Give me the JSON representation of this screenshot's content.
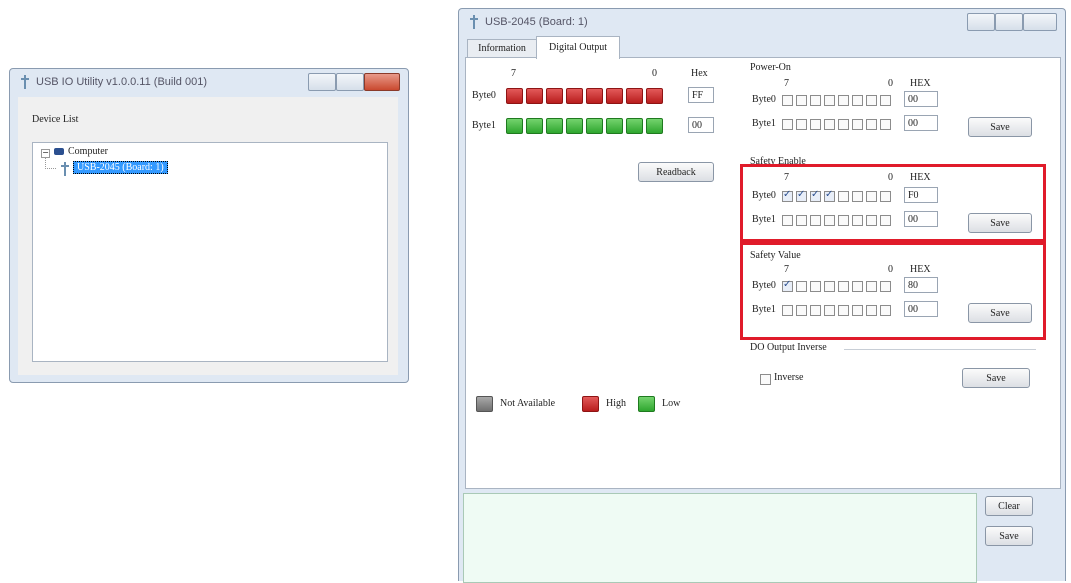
{
  "left_window": {
    "title": "USB IO Utility    v1.0.0.11 (Build 001)",
    "device_list_label": "Device List",
    "tree": {
      "root": "Computer",
      "child": "USB-2045 (Board: 1)"
    }
  },
  "right_window": {
    "title": "USB-2045 (Board: 1)",
    "tabs": [
      "Information",
      "Digital Output"
    ],
    "active_tab": "Digital Output",
    "do_panel": {
      "bit_high": "7",
      "bit_low": "0",
      "hex_header": "Hex",
      "byte0_label": "Byte0",
      "byte1_label": "Byte1",
      "byte0_hex": "FF",
      "byte1_hex": "00",
      "byte0_states": [
        "high",
        "high",
        "high",
        "high",
        "high",
        "high",
        "high",
        "high"
      ],
      "byte1_states": [
        "low",
        "low",
        "low",
        "low",
        "low",
        "low",
        "low",
        "low"
      ],
      "readback_label": "Readback"
    },
    "legend": {
      "not_available": "Not Available",
      "high": "High",
      "low": "Low"
    },
    "power_on": {
      "title": "Power-On",
      "bit_high": "7",
      "bit_low": "0",
      "hex_header": "HEX",
      "byte0_label": "Byte0",
      "byte1_label": "Byte1",
      "byte0_hex": "00",
      "byte1_hex": "00",
      "byte0_bits": [
        false,
        false,
        false,
        false,
        false,
        false,
        false,
        false
      ],
      "byte1_bits": [
        false,
        false,
        false,
        false,
        false,
        false,
        false,
        false
      ],
      "save_label": "Save"
    },
    "safety_enable": {
      "title": "Safety Enable",
      "bit_high": "7",
      "bit_low": "0",
      "hex_header": "HEX",
      "byte0_label": "Byte0",
      "byte1_label": "Byte1",
      "byte0_hex": "F0",
      "byte1_hex": "00",
      "byte0_bits": [
        true,
        true,
        true,
        true,
        false,
        false,
        false,
        false
      ],
      "byte1_bits": [
        false,
        false,
        false,
        false,
        false,
        false,
        false,
        false
      ],
      "save_label": "Save"
    },
    "safety_value": {
      "title": "Safety Value",
      "bit_high": "7",
      "bit_low": "0",
      "hex_header": "HEX",
      "byte0_label": "Byte0",
      "byte1_label": "Byte1",
      "byte0_hex": "80",
      "byte1_hex": "00",
      "byte0_bits": [
        true,
        false,
        false,
        false,
        false,
        false,
        false,
        false
      ],
      "byte1_bits": [
        false,
        false,
        false,
        false,
        false,
        false,
        false,
        false
      ],
      "save_label": "Save"
    },
    "do_inverse": {
      "title": "DO Output Inverse",
      "inverse_label": "Inverse",
      "inverse_checked": false,
      "save_label": "Save"
    },
    "log": {
      "clear_label": "Clear",
      "save_label": "Save"
    }
  },
  "colors": {
    "highlight_box": "#e01b2a",
    "led_high": "#c8262a",
    "led_low": "#3cb33a",
    "led_na": "#808080",
    "log_bg": "#effbf4",
    "selection": "#3399ff"
  }
}
